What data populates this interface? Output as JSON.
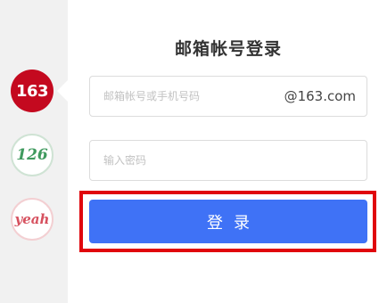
{
  "brands": [
    {
      "label": "163",
      "active": true
    },
    {
      "label": "126",
      "active": false
    },
    {
      "label": "yeah",
      "active": false
    }
  ],
  "login_form": {
    "title": "邮箱帐号登录",
    "account_placeholder": "邮箱帐号或手机号码",
    "domain_suffix": "@163.com",
    "password_placeholder": "输入密码",
    "login_button_label": "登录"
  },
  "colors": {
    "brand_163": "#c4091f",
    "brand_126": "#3f9a5e",
    "brand_yeah": "#d6505e",
    "login_button": "#3f72f6",
    "highlight_frame": "#e0060d",
    "sidebar_bg": "#f1f1f1"
  }
}
